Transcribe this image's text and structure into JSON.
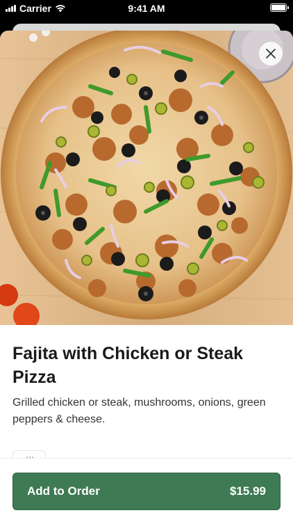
{
  "status_bar": {
    "carrier": "Carrier",
    "time": "9:41 AM"
  },
  "item": {
    "title": "Fajita with Chicken or Steak Pizza",
    "description": "Grilled chicken or steak, mushrooms, onions, green peppers & cheese.",
    "image_icon": "pizza-photo"
  },
  "footer": {
    "add_label": "Add to Order",
    "price": "$15.99"
  },
  "colors": {
    "accent": "#3e7a53"
  }
}
